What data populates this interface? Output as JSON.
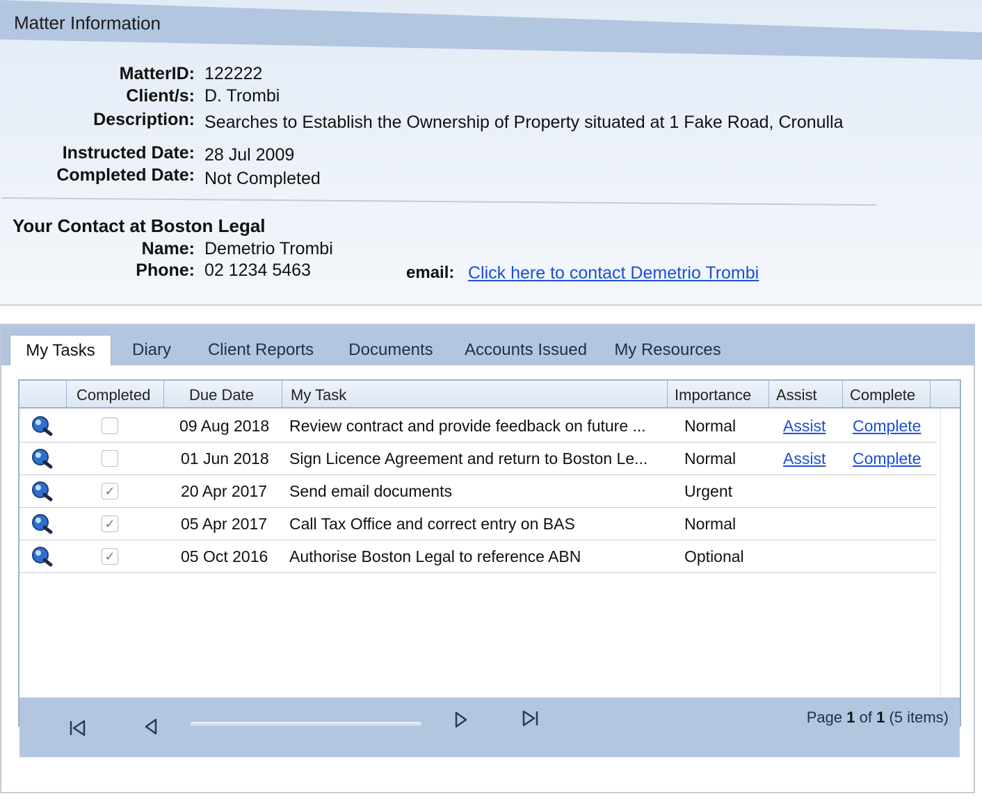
{
  "matter": {
    "header_title": "Matter Information",
    "matter_id_label": "MatterID:",
    "matter_id": "122222",
    "clients_label": "Client/s:",
    "clients": "D. Trombi",
    "description_label": "Description:",
    "description": "Searches to Establish the Ownership of Property situated at 1 Fake Road, Cronulla",
    "instructed_label": "Instructed Date:",
    "instructed_date": "28 Jul 2009",
    "completed_label": "Completed Date:",
    "completed_date": "Not Completed"
  },
  "contact": {
    "heading": "Your Contact at Boston Legal",
    "name_label": "Name:",
    "name": "Demetrio Trombi",
    "phone_label": "Phone:",
    "phone": "02 1234 5463",
    "email_label": "email:",
    "email_link": "Click here to contact Demetrio Trombi"
  },
  "tabs": [
    {
      "label": "My Tasks",
      "active": true
    },
    {
      "label": "Diary"
    },
    {
      "label": "Client Reports"
    },
    {
      "label": "Documents"
    },
    {
      "label": "Accounts Issued"
    },
    {
      "label": "My Resources"
    }
  ],
  "grid": {
    "columns": {
      "completed": "Completed",
      "due_date": "Due Date",
      "my_task": "My Task",
      "importance": "Importance",
      "assist": "Assist",
      "complete": "Complete"
    },
    "rows": [
      {
        "completed": false,
        "checkmark": "",
        "due_date": "09 Aug 2018",
        "task": "Review contract and provide feedback on future ...",
        "importance": "Normal",
        "assist": "Assist",
        "complete": "Complete"
      },
      {
        "completed": false,
        "checkmark": "",
        "due_date": "01 Jun 2018",
        "task": "Sign Licence Agreement and return to Boston Le...",
        "importance": "Normal",
        "assist": "Assist",
        "complete": "Complete"
      },
      {
        "completed": true,
        "checkmark": "✓",
        "due_date": "20 Apr 2017",
        "task": "Send email documents",
        "importance": "Urgent",
        "assist": "",
        "complete": ""
      },
      {
        "completed": true,
        "checkmark": "✓",
        "due_date": "05 Apr 2017",
        "task": "Call Tax Office and correct entry on BAS",
        "importance": "Normal",
        "assist": "",
        "complete": ""
      },
      {
        "completed": true,
        "checkmark": "✓",
        "due_date": "05 Oct 2016",
        "task": "Authorise Boston Legal to reference ABN",
        "importance": "Optional",
        "assist": "",
        "complete": ""
      }
    ]
  },
  "pager": {
    "page_word": "Page",
    "current_page": "1",
    "of_word": "of",
    "total_pages": "1",
    "items_text": "(5 items)"
  },
  "colors": {
    "header_blue": "#b3c6e0",
    "link_blue": "#1a4fd6",
    "panel_bg": "#e3ebf6"
  },
  "icons": [
    "search-magnifier-icon",
    "first-page-icon",
    "previous-page-icon",
    "next-page-icon",
    "last-page-icon"
  ]
}
